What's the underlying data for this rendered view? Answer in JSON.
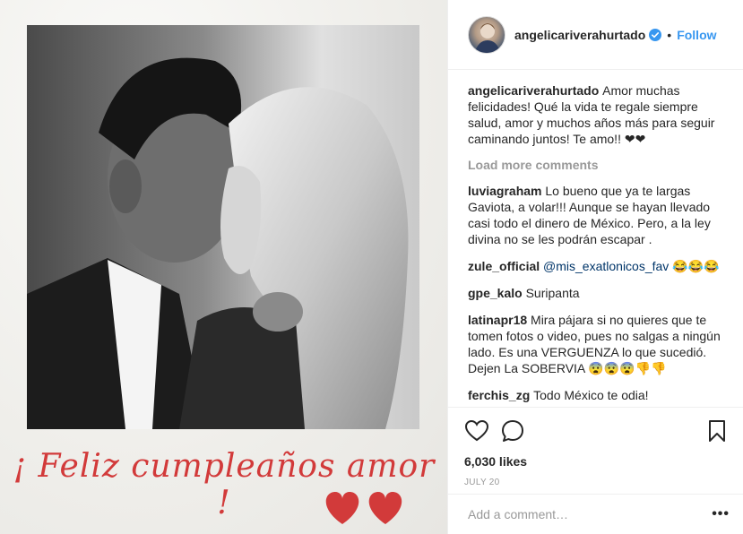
{
  "post": {
    "caption_script": "¡ Feliz cumpleaños amor !"
  },
  "header": {
    "username": "angelicariverahurtado",
    "follow_label": "Follow",
    "dot": "•"
  },
  "comments": [
    {
      "user": "angelicariverahurtado",
      "text": "Amor muchas felicidades! Qué la vida te regale siempre salud, amor y muchos años más para seguir caminando juntos! Te amo!! ❤❤"
    },
    {
      "user": "luviagraham",
      "text": "Lo bueno que ya te largas Gaviota, a volar!!! Aunque se hayan llevado casi todo el dinero de México. Pero, a la ley divina no se les podrán escapar ."
    },
    {
      "user": "zule_official",
      "mention": "@mis_exatlonicos_fav",
      "text": " 😂😂😂"
    },
    {
      "user": "gpe_kalo",
      "text": "Suripanta"
    },
    {
      "user": "latinapr18",
      "text": "Mira pájara si no quieres que te tomen fotos o video, pues no salgas a ningún lado. Es una VERGUENZA lo que sucedió. Dejen La SOBERVIA 😨😨😨👎👎"
    },
    {
      "user": "ferchis_zg",
      "text": "Todo México te odia!"
    }
  ],
  "load_more_label": "Load more comments",
  "actions": {
    "likes": "6,030 likes",
    "date": "JULY 20"
  },
  "add_comment": {
    "placeholder": "Add a comment…",
    "more_label": "•••"
  },
  "colors": {
    "accent": "#3897f0",
    "script_red": "#d23a3a",
    "muted": "#999999"
  }
}
